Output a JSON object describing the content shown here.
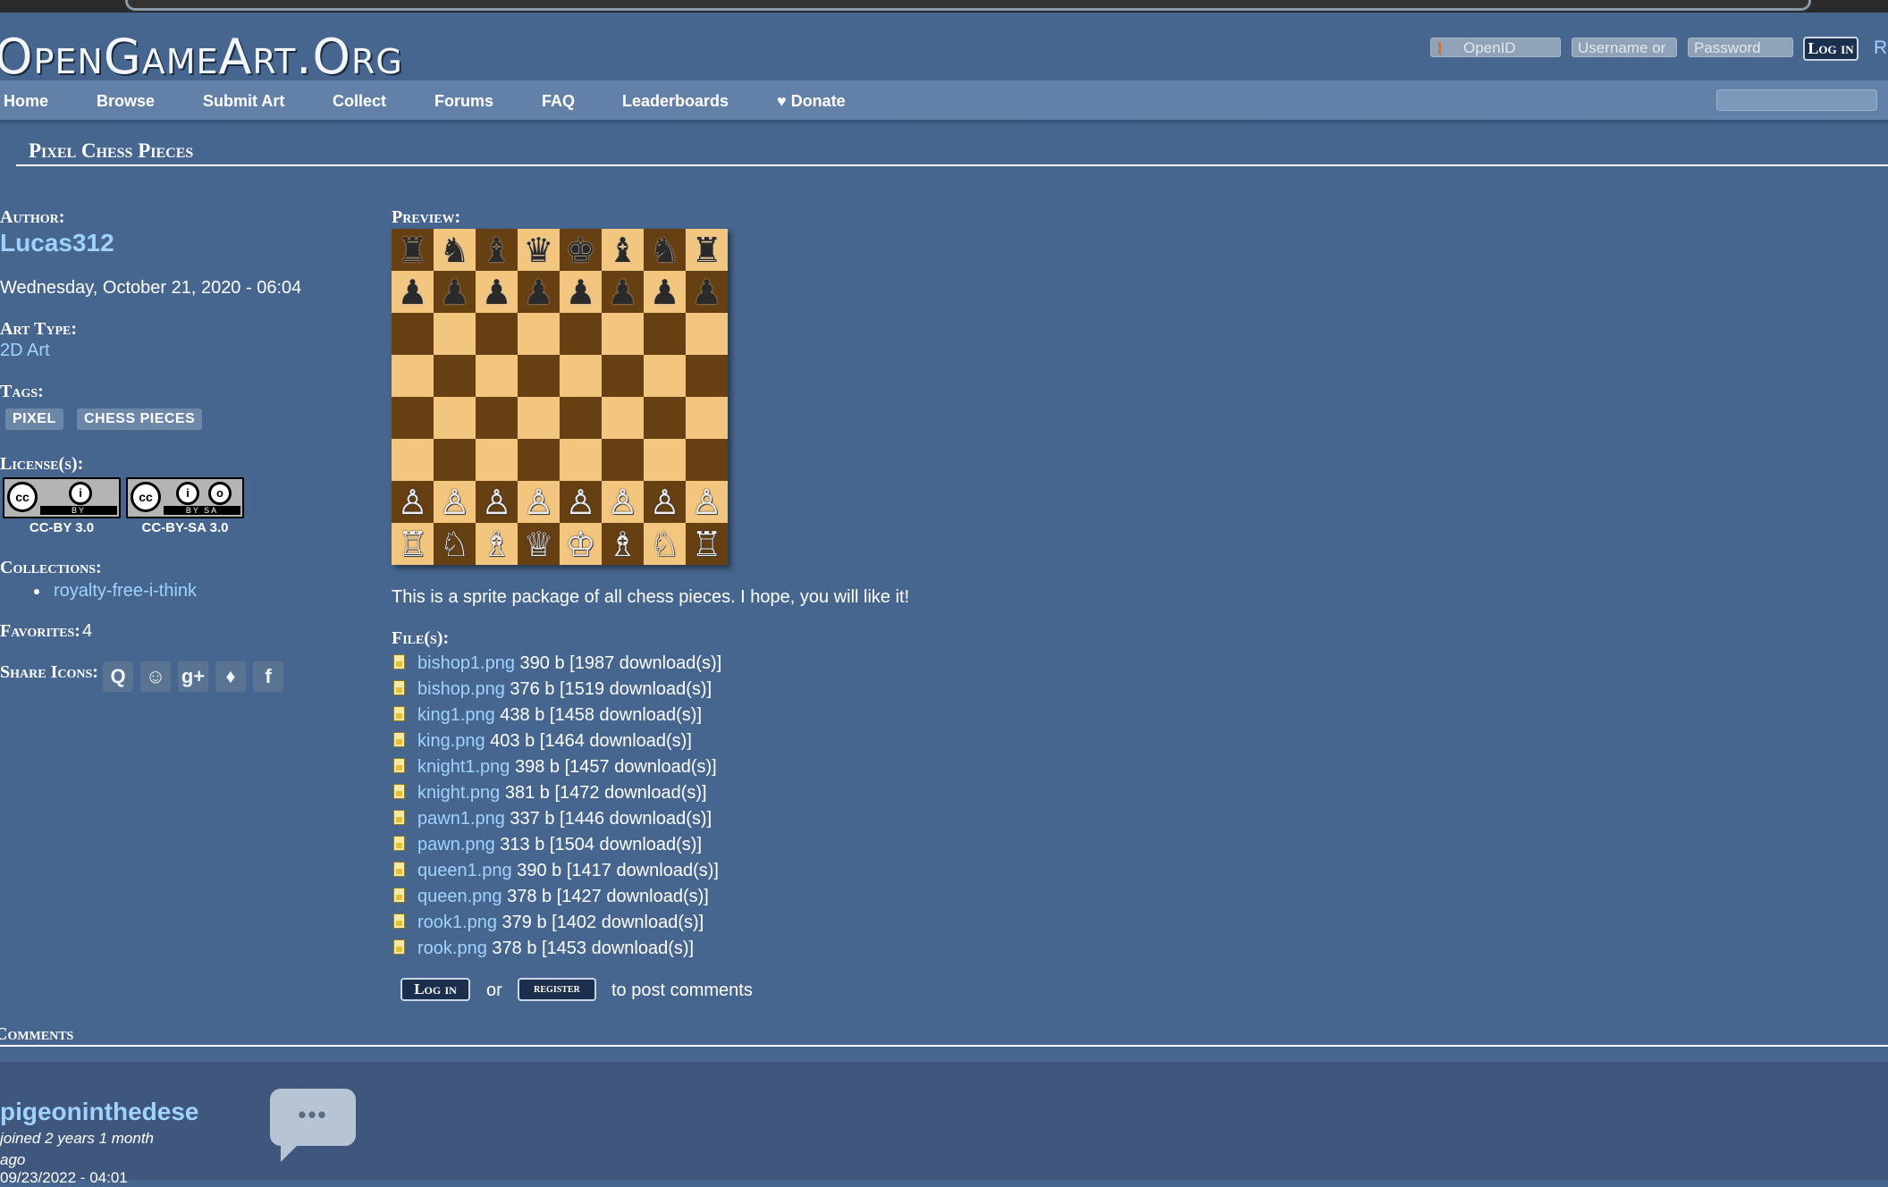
{
  "header": {
    "logo": "OpenGameArt.Org",
    "openid_placeholder": "OpenID",
    "username_placeholder": "Username or",
    "password_placeholder": "Password",
    "login_button": "Log in",
    "register_partial": "R"
  },
  "nav": {
    "items": [
      "Home",
      "Browse",
      "Submit Art",
      "Collect",
      "Forums",
      "FAQ",
      "Leaderboards",
      "♥ Donate"
    ]
  },
  "page": {
    "title": "Pixel Chess Pieces",
    "author_label": "Author:",
    "author": "Lucas312",
    "date": "Wednesday, October 21, 2020 - 06:04",
    "art_type_label": "Art Type:",
    "art_type": "2D Art",
    "tags_label": "Tags:",
    "tags": [
      "PIXEL",
      "CHESS PIECES"
    ],
    "licenses_label": "License(s):",
    "licenses": [
      "CC-BY 3.0",
      "CC-BY-SA 3.0"
    ],
    "collections_label": "Collections:",
    "collections": [
      "royalty-free-i-think"
    ],
    "favorites_label": "Favorites:",
    "favorites": "4",
    "share_label": "Share Icons:",
    "preview_label": "Preview:",
    "description": "This is a sprite package of all chess pieces. I hope, you will like it!",
    "files_label": "File(s):",
    "files": [
      {
        "name": "bishop1.png",
        "meta": " 390 b [1987 download(s)]"
      },
      {
        "name": "bishop.png",
        "meta": " 376 b [1519 download(s)]"
      },
      {
        "name": "king1.png",
        "meta": " 438 b [1458 download(s)]"
      },
      {
        "name": "king.png",
        "meta": " 403 b [1464 download(s)]"
      },
      {
        "name": "knight1.png",
        "meta": " 398 b [1457 download(s)]"
      },
      {
        "name": "knight.png",
        "meta": " 381 b [1472 download(s)]"
      },
      {
        "name": "pawn1.png",
        "meta": " 337 b [1446 download(s)]"
      },
      {
        "name": "pawn.png",
        "meta": " 313 b [1504 download(s)]"
      },
      {
        "name": "queen1.png",
        "meta": " 390 b [1417 download(s)]"
      },
      {
        "name": "queen.png",
        "meta": " 378 b [1427 download(s)]"
      },
      {
        "name": "rook1.png",
        "meta": " 379 b [1402 download(s)]"
      },
      {
        "name": "rook.png",
        "meta": " 378 b [1453 download(s)]"
      }
    ],
    "post": {
      "login": "Log in",
      "or": "or",
      "register": "register",
      "suffix": "to post comments"
    }
  },
  "comments": {
    "title": "Comments",
    "user": "pigeoninthedese",
    "joined": "joined 2 years 1 month ago",
    "date": "09/23/2022 - 04:01"
  },
  "icons": {
    "share": [
      "openid-icon",
      "reddit-icon",
      "google-plus-icon",
      "twitter-icon",
      "facebook-icon"
    ]
  },
  "board": {
    "rows": [
      [
        "♜",
        "♞",
        "♝",
        "♛",
        "♚",
        "♝",
        "♞",
        "♜"
      ],
      [
        "♟",
        "♟",
        "♟",
        "♟",
        "♟",
        "♟",
        "♟",
        "♟"
      ],
      [
        "",
        "",
        "",
        "",
        "",
        "",
        "",
        ""
      ],
      [
        "",
        "",
        "",
        "",
        "",
        "",
        "",
        ""
      ],
      [
        "",
        "",
        "",
        "",
        "",
        "",
        "",
        ""
      ],
      [
        "",
        "",
        "",
        "",
        "",
        "",
        "",
        ""
      ],
      [
        "♙",
        "♙",
        "♙",
        "♙",
        "♙",
        "♙",
        "♙",
        "♙"
      ],
      [
        "♖",
        "♘",
        "♗",
        "♕",
        "♔",
        "♗",
        "♘",
        "♖"
      ]
    ]
  }
}
